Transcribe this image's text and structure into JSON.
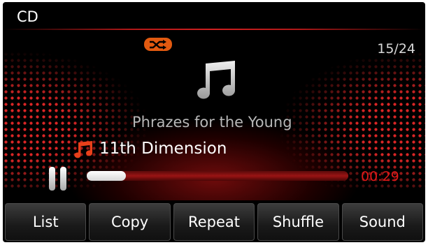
{
  "header": {
    "title": "CD"
  },
  "player": {
    "track_count": "15/24",
    "album_title": "Phrazes for the Young",
    "song_title": "11th Dimension",
    "elapsed_time": "00:29",
    "progress": 0.15,
    "shuffle_on": true
  },
  "buttons": [
    {
      "label": "List"
    },
    {
      "label": "Copy"
    },
    {
      "label": "Repeat"
    },
    {
      "label": "Shuffle"
    },
    {
      "label": "Sound"
    }
  ],
  "colors": {
    "accent_red": "#e01818",
    "shuffle_orange": "#e25a10",
    "background": "#000000"
  },
  "icons": {
    "shuffle": "shuffle-icon",
    "album_note": "music-note-icon",
    "song_note": "music-note-icon",
    "pause": "pause-icon"
  }
}
